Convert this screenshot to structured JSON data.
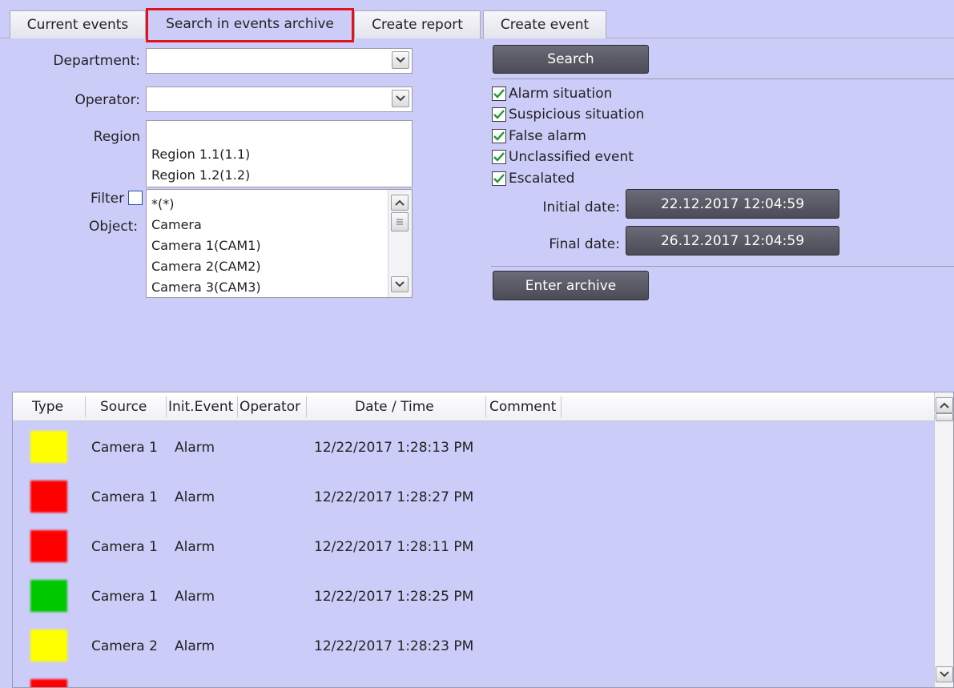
{
  "tabs": [
    {
      "label": "Current events"
    },
    {
      "label": "Search in events archive"
    },
    {
      "label": "Create report"
    },
    {
      "label": "Create event"
    }
  ],
  "form": {
    "department_label": "Department:",
    "department_value": "",
    "operator_label": "Operator:",
    "operator_value": "",
    "region_label": "Region",
    "regions": [
      "",
      "Region 1.1(1.1)",
      "Region 1.2(1.2)"
    ],
    "filter_label": "Filter",
    "filter_checked": false,
    "object_label": "Object:",
    "objects": [
      "*(*)",
      "Camera",
      "Camera 1(CAM1)",
      "Camera 2(CAM2)",
      "Camera 3(CAM3)"
    ]
  },
  "search": {
    "search_button": "Search",
    "checkboxes": [
      {
        "label": "Alarm situation",
        "checked": true
      },
      {
        "label": "Suspicious situation",
        "checked": true
      },
      {
        "label": "False alarm",
        "checked": true
      },
      {
        "label": "Unclassified event",
        "checked": true
      },
      {
        "label": "Escalated",
        "checked": true
      }
    ],
    "initial_date_label": "Initial date:",
    "initial_date_value": "22.12.2017 12:04:59",
    "final_date_label": "Final date:",
    "final_date_value": "26.12.2017 12:04:59",
    "enter_archive_button": "Enter archive"
  },
  "table": {
    "columns": [
      "Type",
      "Source",
      "Init.Event",
      "Operator",
      "Date / Time",
      "Comment"
    ],
    "rows": [
      {
        "type_color": "#ffff00",
        "source": "Camera 1",
        "init_event": "Alarm",
        "operator": "",
        "datetime": "12/22/2017 1:28:13 PM",
        "comment": ""
      },
      {
        "type_color": "#ff0000",
        "source": "Camera 1",
        "init_event": "Alarm",
        "operator": "",
        "datetime": "12/22/2017 1:28:27 PM",
        "comment": ""
      },
      {
        "type_color": "#ff0000",
        "source": "Camera 1",
        "init_event": "Alarm",
        "operator": "",
        "datetime": "12/22/2017 1:28:11 PM",
        "comment": ""
      },
      {
        "type_color": "#00c800",
        "source": "Camera 1",
        "init_event": "Alarm",
        "operator": "",
        "datetime": "12/22/2017 1:28:25 PM",
        "comment": ""
      },
      {
        "type_color": "#ffff00",
        "source": "Camera 2",
        "init_event": "Alarm",
        "operator": "",
        "datetime": "12/22/2017 1:28:23 PM",
        "comment": ""
      },
      {
        "type_color": "#ff0000",
        "source": "",
        "init_event": "",
        "operator": "",
        "datetime": "",
        "comment": ""
      }
    ]
  },
  "colors": {
    "background": "#ccccf9",
    "active_tab_highlight": "#e0141e",
    "button_dark": "#55555f",
    "check_green": "#1a9c2a"
  }
}
